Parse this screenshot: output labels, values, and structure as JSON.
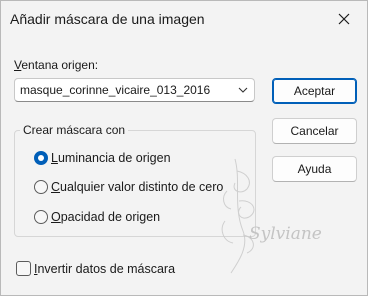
{
  "window": {
    "title": "Añadir máscara de una imagen",
    "close_icon": "close-icon"
  },
  "source": {
    "label_underlined": "V",
    "label_rest": "entana origen:",
    "selected_value": "masque_corinne_vicaire_013_2016",
    "dropdown_icon": "chevron-down-icon"
  },
  "buttons": {
    "accept": "Aceptar",
    "cancel": "Cancelar",
    "help": "Ayuda"
  },
  "mask_group": {
    "legend": "Crear máscara con",
    "options": [
      {
        "underlined": "L",
        "rest": "uminancia de origen",
        "selected": true
      },
      {
        "underlined": "C",
        "rest": "ualquier valor distinto de cero",
        "selected": false
      },
      {
        "underlined": "O",
        "rest": "pacidad de origen",
        "selected": false
      }
    ]
  },
  "invert": {
    "underlined": "I",
    "rest": "nvertir datos de máscara",
    "checked": false
  },
  "watermark": {
    "text": "Sylviane"
  },
  "colors": {
    "accent": "#005fb8",
    "background": "#f3f3f3"
  }
}
